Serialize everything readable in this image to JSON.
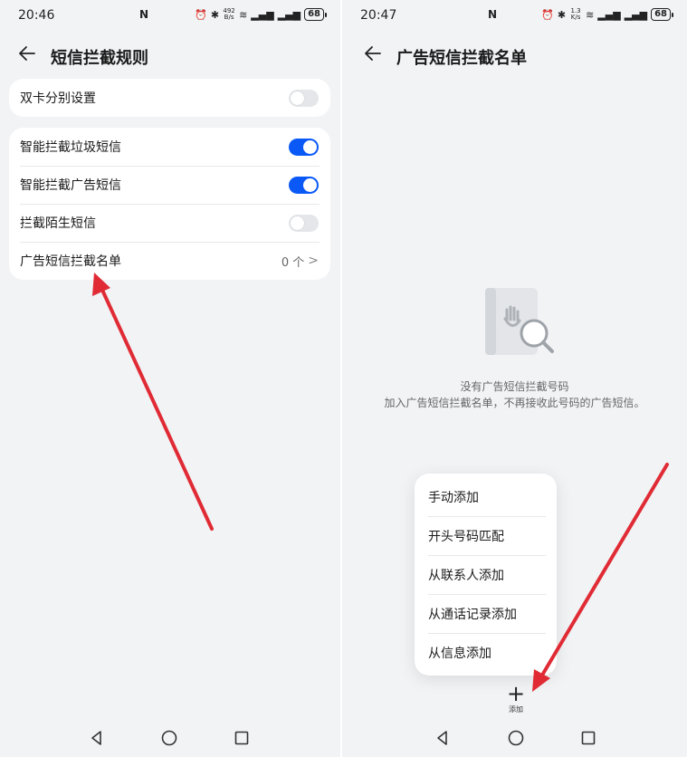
{
  "left": {
    "status": {
      "time": "20:46",
      "nfc": "N",
      "speed_top": "492",
      "speed_bottom": "B/s",
      "battery": "68"
    },
    "title": "短信拦截规则",
    "section1": [
      {
        "label": "双卡分别设置",
        "toggle": "off"
      }
    ],
    "section2": [
      {
        "label": "智能拦截垃圾短信",
        "toggle": "on"
      },
      {
        "label": "智能拦截广告短信",
        "toggle": "on"
      },
      {
        "label": "拦截陌生短信",
        "toggle": "off"
      }
    ],
    "blocklist_row": {
      "label": "广告短信拦截名单",
      "count": "0 个",
      "chevron": ">"
    }
  },
  "right": {
    "status": {
      "time": "20:47",
      "nfc": "N",
      "speed_top": "1.3",
      "speed_bottom": "K/s",
      "battery": "68"
    },
    "title": "广告短信拦截名单",
    "empty_title": "没有广告短信拦截号码",
    "empty_desc": "加入广告短信拦截名单，不再接收此号码的广告短信。",
    "menu": [
      "手动添加",
      "开头号码匹配",
      "从联系人添加",
      "从通话记录添加",
      "从信息添加"
    ],
    "add_label": "添加"
  },
  "colors": {
    "accent": "#0a59f7",
    "annotation_arrow": "#e02b35",
    "background": "#f1f3f5"
  },
  "icons": [
    "back-arrow-icon",
    "alarm-icon",
    "bluetooth-icon",
    "wifi-icon",
    "signal-icon",
    "battery-icon",
    "nav-back-icon",
    "nav-home-icon",
    "nav-recents-icon",
    "empty-blocklist-illustration",
    "plus-icon"
  ]
}
